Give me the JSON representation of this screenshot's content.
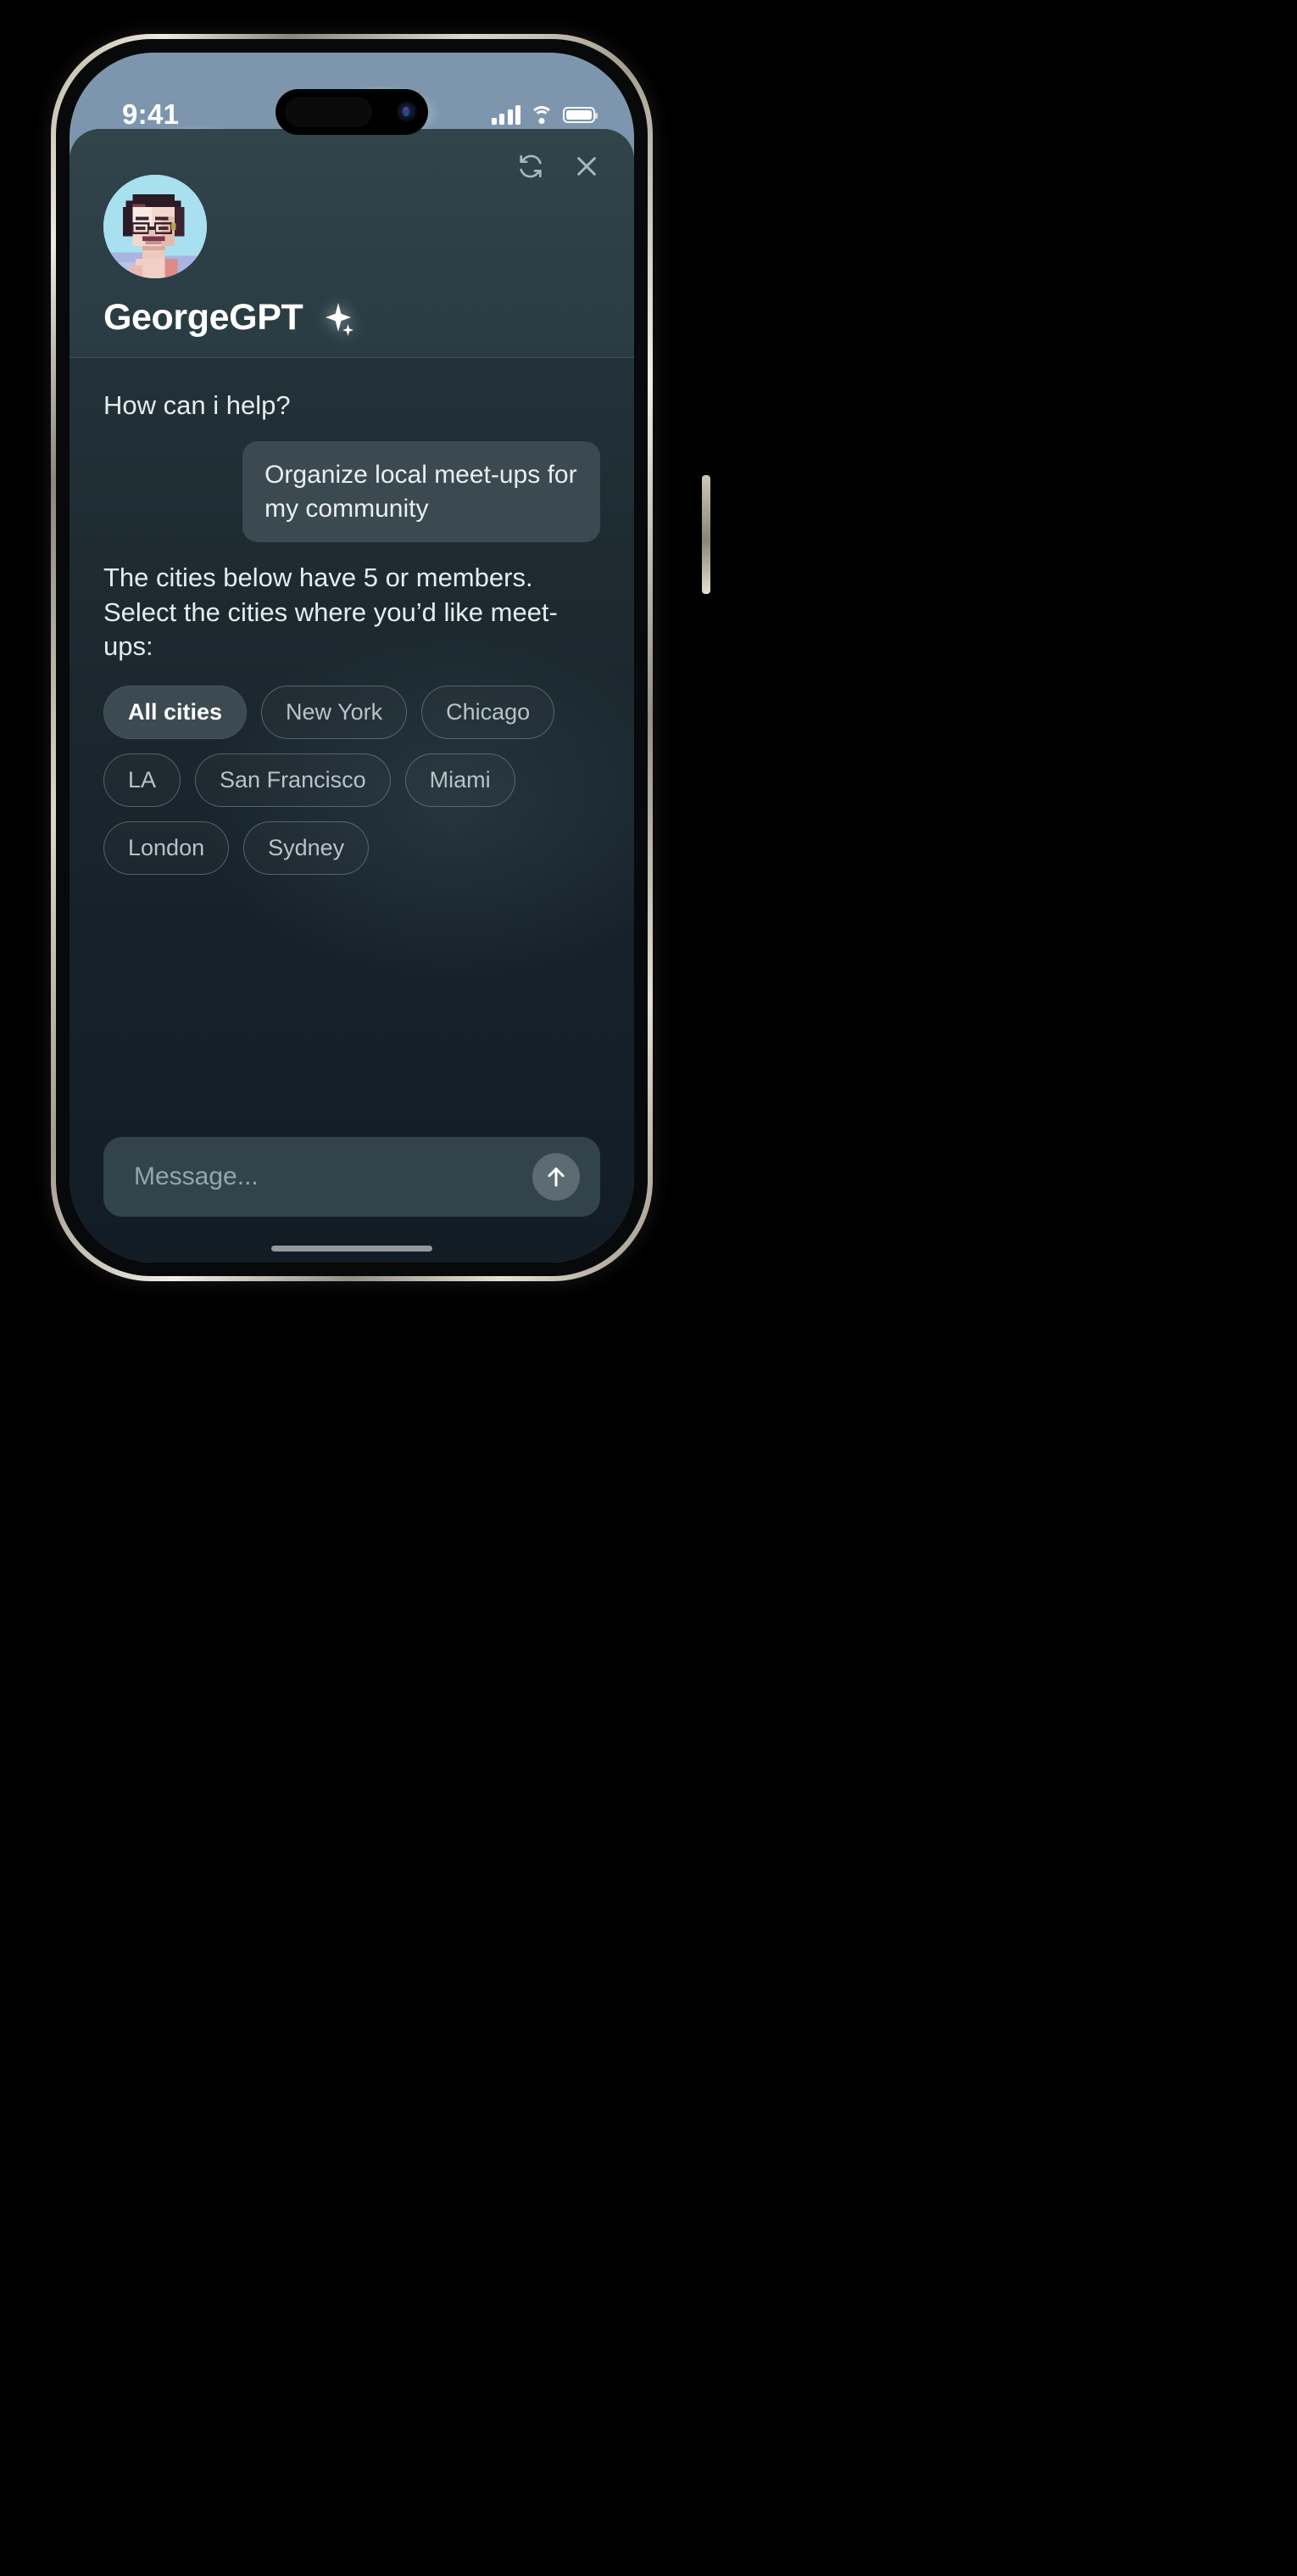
{
  "device": {
    "status_bar": {
      "time": "9:41",
      "cellular_icon": "cellular-signal-icon",
      "wifi_icon": "wifi-icon",
      "battery_icon": "battery-full-icon"
    },
    "dynamic_island": "dynamic-island",
    "home_indicator": "home-indicator"
  },
  "header": {
    "bot_name": "GeorgeGPT",
    "sparkle_icon": "sparkle-icon",
    "avatar": "pixel-art-avatar",
    "actions": [
      {
        "name": "refresh-button",
        "icon": "refresh-icon"
      },
      {
        "name": "close-button",
        "icon": "close-icon"
      }
    ]
  },
  "conversation": {
    "greeting": "How can i help?",
    "user_message": "Organize local meet-ups for my community",
    "bot_reply": "The cities below have 5 or members. Select the cities where you’d like meet-ups:",
    "chips": [
      {
        "label": "All cities",
        "selected": true
      },
      {
        "label": "New York",
        "selected": false
      },
      {
        "label": "Chicago",
        "selected": false
      },
      {
        "label": "LA",
        "selected": false
      },
      {
        "label": "San Francisco",
        "selected": false
      },
      {
        "label": "Miami",
        "selected": false
      },
      {
        "label": "London",
        "selected": false
      },
      {
        "label": "Sydney",
        "selected": false
      }
    ]
  },
  "composer": {
    "placeholder": "Message...",
    "send_icon": "arrow-up-icon"
  },
  "colors": {
    "sheet_top": "#2f4249",
    "sheet_bottom": "#121c24",
    "bubble": "#3b4a50",
    "chip_selected": "#3c4b51",
    "text_primary": "#e4ecee",
    "text_muted": "#b6c3c8",
    "send_button": "#5d6c72"
  }
}
